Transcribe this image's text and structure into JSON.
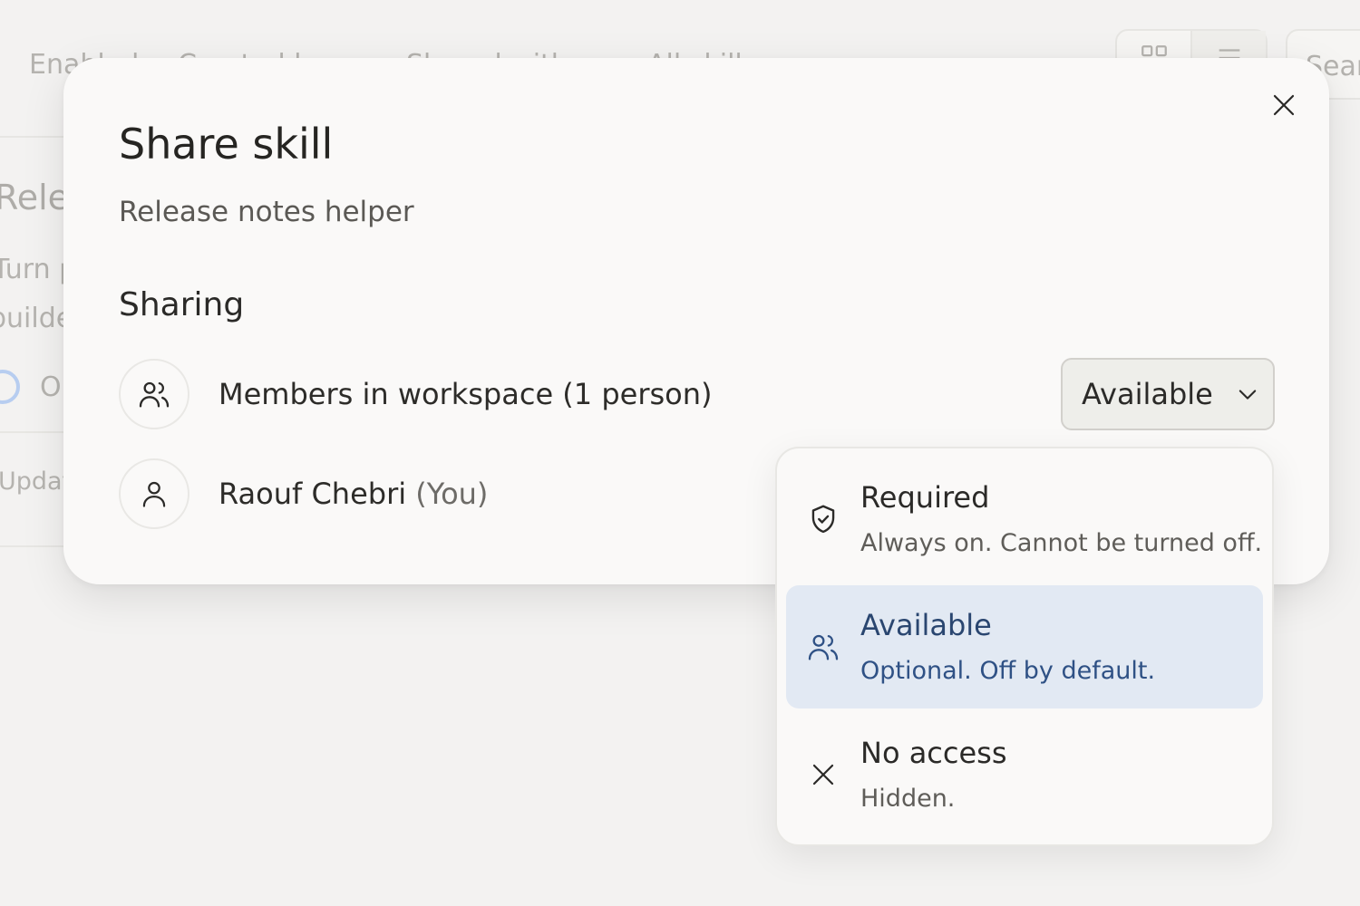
{
  "background": {
    "tabs": [
      "Enabled",
      "Created by me",
      "Shared with me",
      "All skills"
    ],
    "search_placeholder": "Search",
    "card_title": "Release notes helper",
    "card_desc_1": "Turn pr",
    "card_desc_2": "builder-",
    "card_toggle_label": "O",
    "card_meta": "Updated"
  },
  "modal": {
    "title": "Share skill",
    "subtitle": "Release notes helper",
    "section_title": "Sharing",
    "rows": [
      {
        "label": "Members in workspace (1 person)",
        "icon": "users-icon"
      },
      {
        "label": "Raouf Chebri",
        "suffix": "(You)",
        "icon": "user-icon"
      }
    ],
    "select_value": "Available"
  },
  "dropdown": {
    "options": [
      {
        "title": "Required",
        "desc": "Always on. Cannot be turned off.",
        "icon": "shield-check-icon",
        "selected": false
      },
      {
        "title": "Available",
        "desc": "Optional. Off by default.",
        "icon": "users-icon",
        "selected": true
      },
      {
        "title": "No access",
        "desc": "Hidden.",
        "icon": "close-icon",
        "selected": false
      }
    ]
  },
  "colors": {
    "selected_bg": "#e2e9f3",
    "selected_text": "#2f5185",
    "modal_bg": "#faf9f8",
    "page_bg": "#f3f2f1"
  }
}
